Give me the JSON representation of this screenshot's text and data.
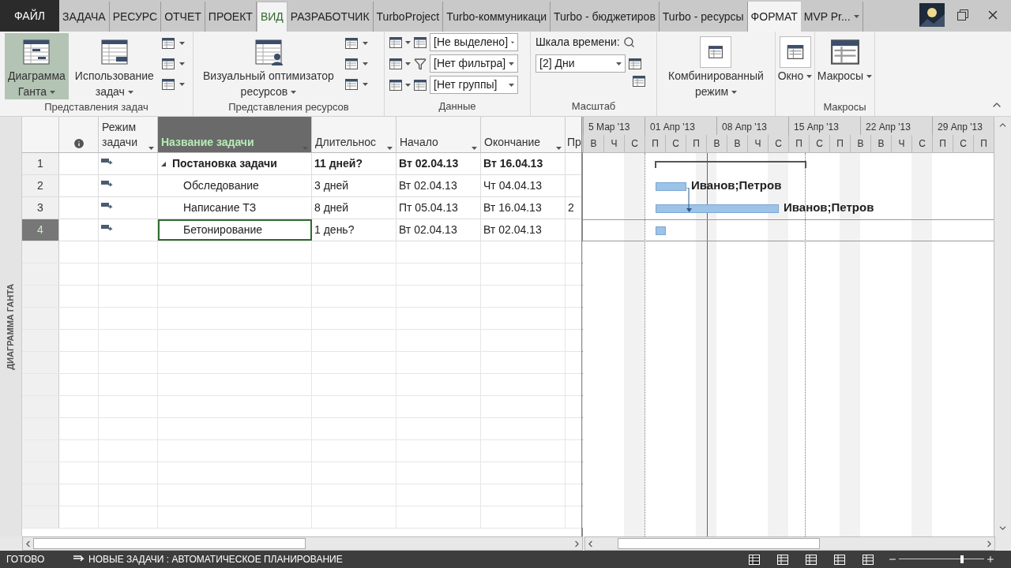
{
  "tabs": [
    {
      "label": "ФАЙЛ",
      "kind": "file",
      "selected": false
    },
    {
      "label": "ЗАДАЧА",
      "kind": "tab",
      "selected": false
    },
    {
      "label": "РЕСУРС",
      "kind": "tab",
      "selected": false
    },
    {
      "label": "ОТЧЕТ",
      "kind": "tab",
      "selected": false
    },
    {
      "label": "ПРОЕКТ",
      "kind": "tab",
      "selected": false
    },
    {
      "label": "ВИД",
      "kind": "tab",
      "selected": true
    },
    {
      "label": "РАЗРАБОТЧИК",
      "kind": "tab",
      "selected": false
    },
    {
      "label": "TurboProject",
      "kind": "tab",
      "selected": false
    },
    {
      "label": "Turbo-коммуникаци",
      "kind": "tab",
      "selected": false
    },
    {
      "label": "Turbo - бюджетиров",
      "kind": "tab",
      "selected": false
    },
    {
      "label": "Turbo - ресурсы",
      "kind": "tab",
      "selected": false
    },
    {
      "label": "ФОРМАТ",
      "kind": "contextual",
      "selected": false
    },
    {
      "label": "MVP Pr...",
      "kind": "tab",
      "selected": false
    }
  ],
  "ribbon": {
    "task_views": {
      "label": "Представления задач",
      "gantt": {
        "lines": [
          "Диаграмма",
          "Ганта"
        ],
        "selected": true
      },
      "usage": {
        "lines": [
          "Использование",
          "задач"
        ],
        "selected": false
      }
    },
    "resource_views": {
      "label": "Представления ресурсов",
      "planner": {
        "lines": [
          "Визуальный оптимизатор",
          "ресурсов"
        ]
      }
    },
    "data": {
      "label": "Данные",
      "highlight": "[Не выделено]",
      "filter": "[Нет фильтра]",
      "group": "[Нет группы]"
    },
    "zoom": {
      "label": "Масштаб",
      "timescale_label": "Шкала времени:",
      "timescale": "[2] Дни"
    },
    "split": {
      "lines": [
        "Комбинированный",
        "режим"
      ]
    },
    "window": {
      "lines": [
        "Окно"
      ]
    },
    "macros": {
      "label": "Макросы",
      "button": {
        "lines": [
          "Макросы"
        ]
      }
    }
  },
  "side_label": "ДИАГРАММА ГАНТА",
  "table": {
    "columns": [
      {
        "kind": "rownum",
        "selected": false
      },
      {
        "kind": "info",
        "selected": false
      },
      {
        "label": "Режим задачи",
        "kind": "mode",
        "selected": false
      },
      {
        "label": "Название задачи",
        "kind": "name",
        "selected": true
      },
      {
        "label": "Длительнос",
        "kind": "text",
        "selected": false
      },
      {
        "label": "Начало",
        "kind": "text",
        "selected": false
      },
      {
        "label": "Окончание",
        "kind": "text",
        "selected": false
      },
      {
        "label": "Пр",
        "kind": "text",
        "selected": false
      }
    ],
    "rows": [
      {
        "id": "1",
        "name": "Постановка задачи",
        "duration": "11 дней?",
        "start": "Вт 02.04.13",
        "finish": "Вт 16.04.13",
        "summary": true,
        "expanded": true,
        "selected": false,
        "children": [
          {
            "id": "2",
            "name": "Обследование",
            "duration": "3 дней",
            "start": "Вт 02.04.13",
            "finish": "Чт 04.04.13",
            "summary": false,
            "selected": false,
            "resources": "Иванов;Петров"
          },
          {
            "id": "3",
            "name": "Написание ТЗ",
            "duration": "8 дней",
            "start": "Пт 05.04.13",
            "finish": "Вт 16.04.13",
            "predecessors": "2",
            "summary": false,
            "selected": false,
            "resources": "Иванов;Петров"
          },
          {
            "id": "4",
            "name": "Бетонирование",
            "duration": "1 день?",
            "start": "Вт 02.04.13",
            "finish": "Вт 02.04.13",
            "summary": false,
            "selected": true
          }
        ]
      }
    ]
  },
  "timescale": {
    "weeks": [
      "5 Мар '13",
      "01 Апр '13",
      "08 Апр '13",
      "15 Апр '13",
      "22 Апр '13",
      "29 Апр '13"
    ],
    "days": [
      "В",
      "Ч",
      "С",
      "П",
      "С",
      "П",
      "В",
      "В",
      "Ч",
      "С",
      "П",
      "С",
      "П",
      "В",
      "В",
      "Ч",
      "С",
      "П",
      "С",
      "П"
    ]
  },
  "status_bar": {
    "ready": "ГОТОВО",
    "new_tasks": "НОВЫЕ ЗАДАЧИ : АВТОМАТИЧЕСКОЕ ПЛАНИРОВАНИЕ",
    "zoom": {
      "level": 0.75
    }
  }
}
